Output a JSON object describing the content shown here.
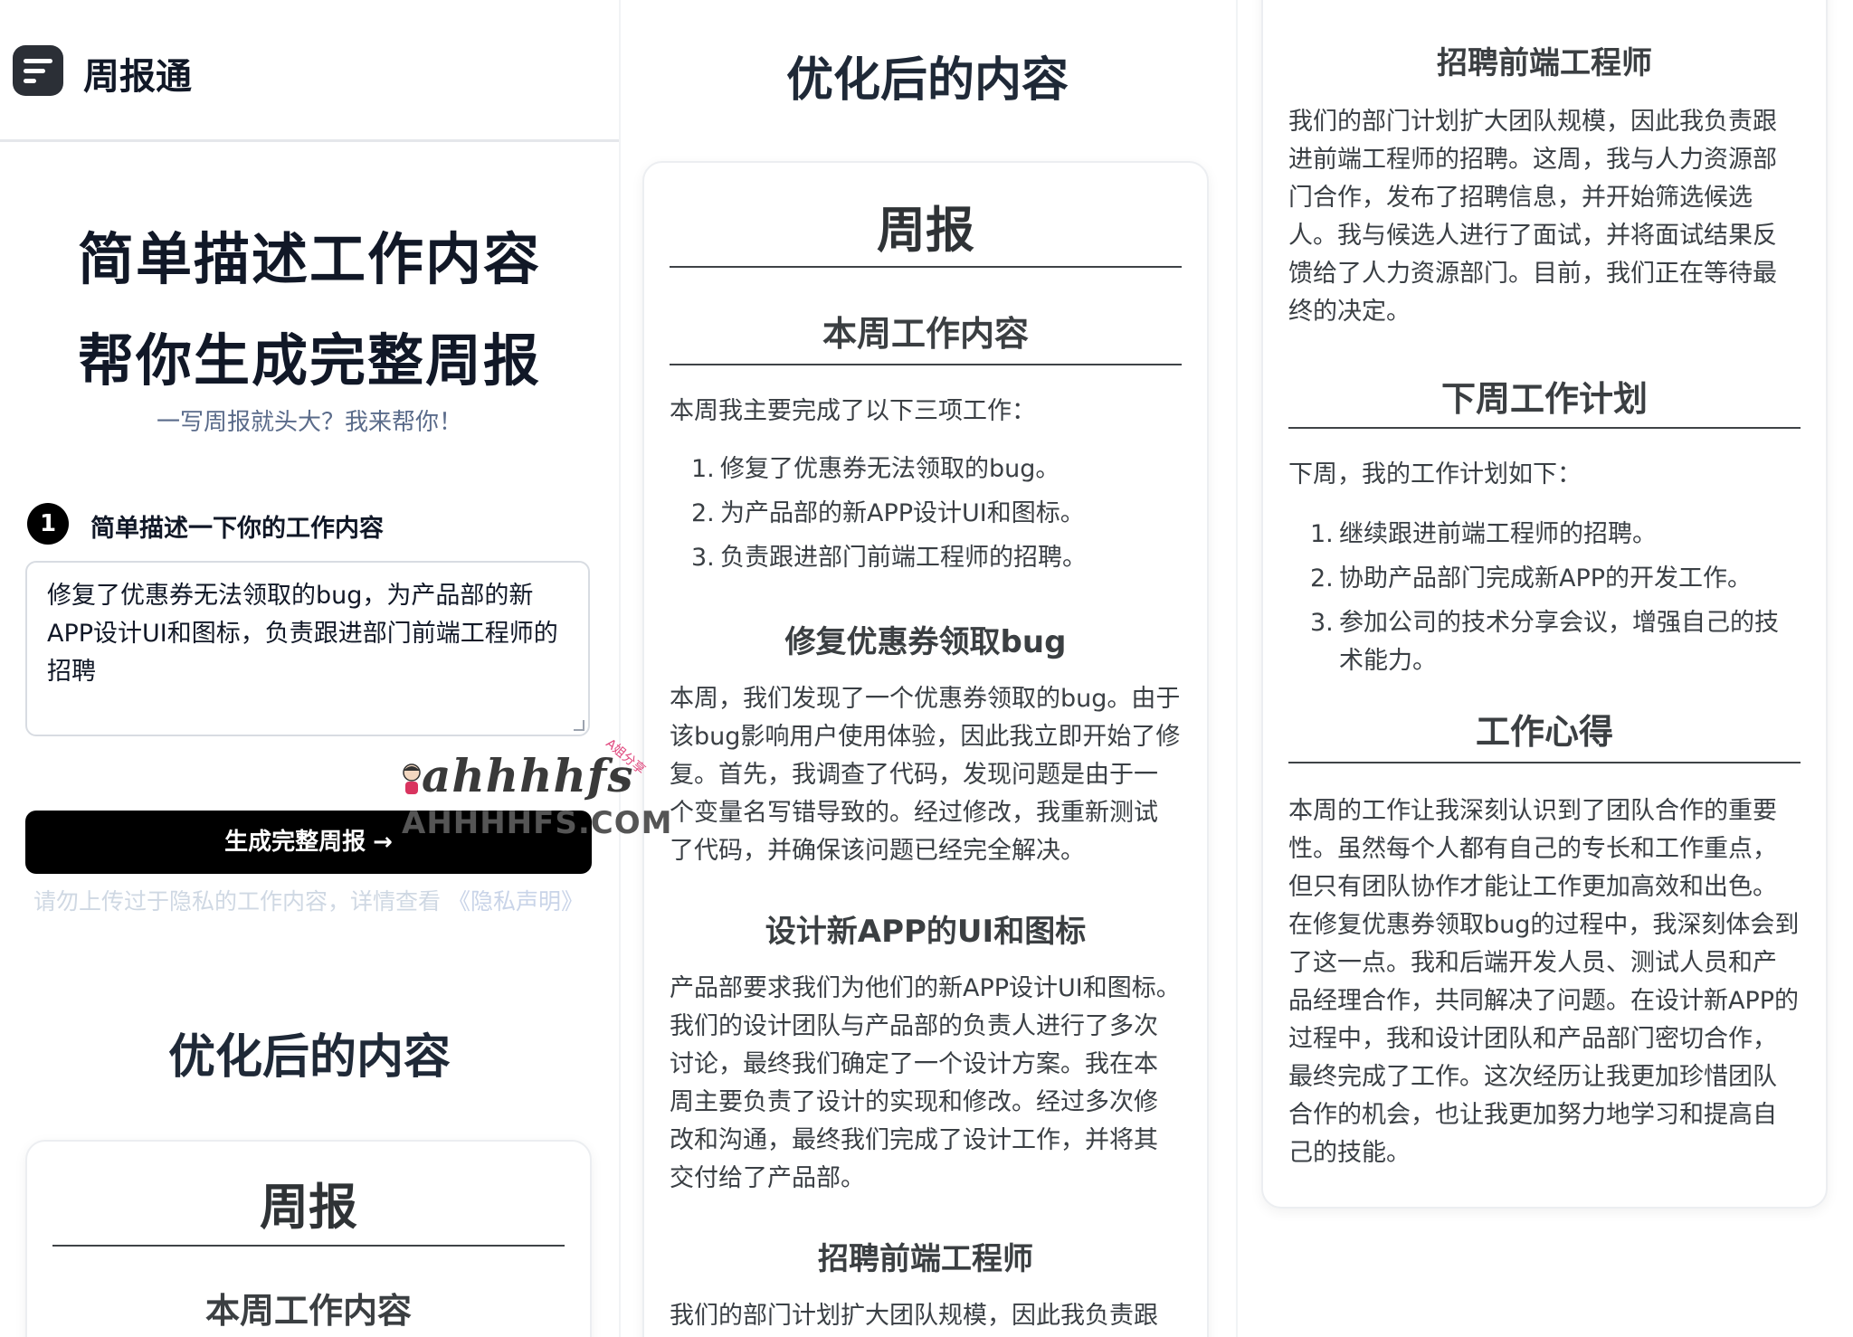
{
  "app": {
    "name": "周报通",
    "logo_icon": "menu-lines-icon"
  },
  "hero": {
    "line1": "简单描述工作内容",
    "line2": "帮你生成完整周报",
    "subtitle": "一写周报就头大？我来帮你！"
  },
  "step": {
    "number": "1",
    "label": "简单描述一下你的工作内容"
  },
  "input": {
    "value": "修复了优惠券无法领取的bug，为产品部的新APP设计UI和图标，负责跟进部门前端工程师的招聘"
  },
  "generate_button": {
    "label": "生成完整周报",
    "arrow": "→"
  },
  "privacy": {
    "text": "请勿上传过于隐私的工作内容，详情查看",
    "link": "《隐私声明》"
  },
  "result": {
    "section_title": "优化后的内容",
    "report_title": "周报",
    "this_week": {
      "heading": "本周工作内容",
      "intro": "本周我主要完成了以下三项工作：",
      "items": [
        "修复了优惠券无法领取的bug。",
        "为产品部的新APP设计UI和图标。",
        "负责跟进部门前端工程师的招聘。"
      ]
    },
    "bug_fix": {
      "heading": "修复优惠券领取bug",
      "text": "本周，我们发现了一个优惠券领取的bug。由于该bug影响用户使用体验，因此我立即开始了修复。首先，我调查了代码，发现问题是由于一个变量名写错导致的。经过修改，我重新测试了代码，并确保该问题已经完全解决。"
    },
    "design": {
      "heading": "设计新APP的UI和图标",
      "text": "产品部要求我们为他们的新APP设计UI和图标。我们的设计团队与产品部的负责人进行了多次讨论，最终我们确定了一个设计方案。我在本周主要负责了设计的实现和修改。经过多次修改和沟通，最终我们完成了设计工作，并将其交付给了产品部。"
    },
    "recruit": {
      "heading": "招聘前端工程师",
      "text": "我们的部门计划扩大团队规模，因此我负责跟进前端工程师的招聘。这周，我与人力资源部门合作，发布了招聘信息，并开始筛选候选人。我与候选人进行了面试，并将面试结果反馈给了人力资源部门。目前，我们正在等待最终的决定。",
      "text_cut": "我们的部门计划扩大团队规模，因此我负责跟"
    },
    "next_week": {
      "heading": "下周工作计划",
      "intro": "下周，我的工作计划如下：",
      "items": [
        "继续跟进前端工程师的招聘。",
        "协助产品部门完成新APP的开发工作。",
        "参加公司的技术分享会议，增强自己的技术能力。"
      ]
    },
    "reflection": {
      "heading": "工作心得",
      "text": "本周的工作让我深刻认识到了团队合作的重要性。虽然每个人都有自己的专长和工作重点，但只有团队协作才能让工作更加高效和出色。在修复优惠券领取bug的过程中，我深刻体会到了这一点。我和后端开发人员、测试人员和产品经理合作，共同解决了问题。在设计新APP的过程中，我和设计团队和产品部门密切合作，最终完成了工作。这次经历让我更加珍惜团队合作的机会，也让我更加努力地学习和提高自己的技能。"
    }
  },
  "watermark": {
    "script": "ahhhhfs",
    "caps": "AHHHHFS.COM",
    "tag": "A姐分享"
  }
}
